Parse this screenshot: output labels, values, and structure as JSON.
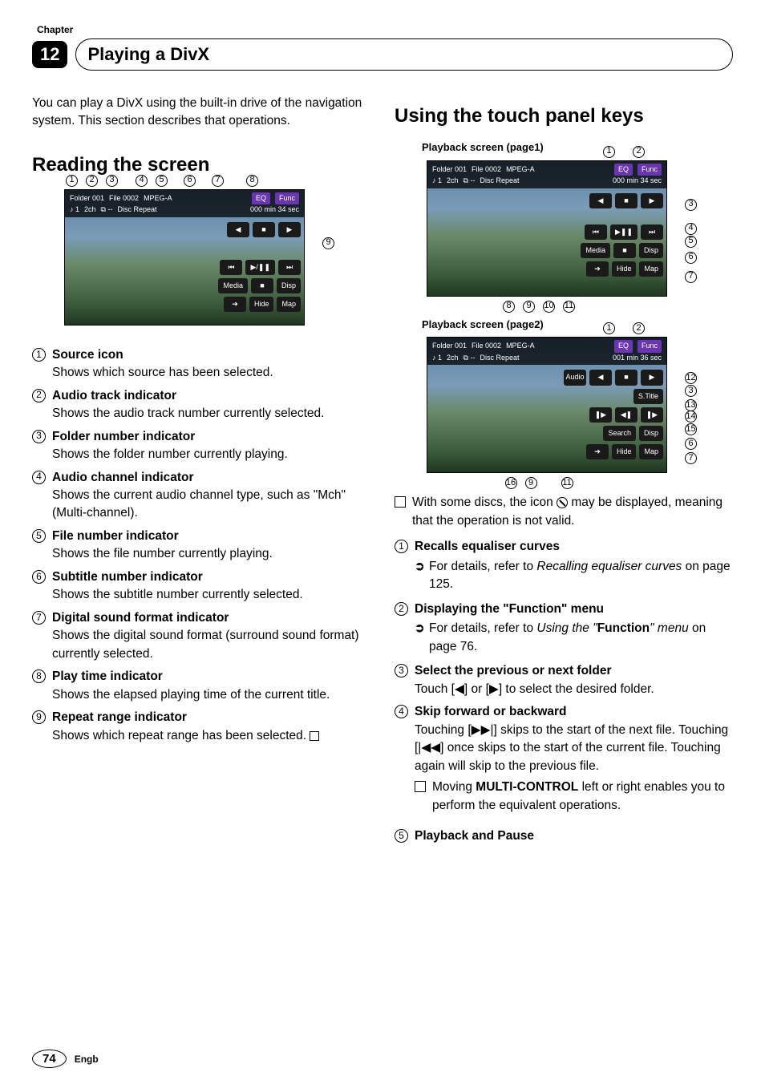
{
  "chapter": {
    "label": "Chapter",
    "number": "12",
    "title": "Playing a DivX"
  },
  "intro": "You can play a DivX using the built-in drive of the navigation system. This section describes that operations.",
  "left": {
    "h2": "Reading the screen",
    "fig": {
      "folder": "Folder 001",
      "file": "File 0002",
      "codec": "MPEG-A",
      "track": "♪ 1",
      "ch": "2ch",
      "sub": "⧉ --",
      "repeat": "Disc Repeat",
      "eq": "EQ",
      "func": "Func",
      "time": "000 min 34 sec",
      "media": "Media",
      "disp": "Disp",
      "hide": "Hide",
      "map": "Map"
    },
    "items": [
      {
        "n": "1",
        "t": "Source icon",
        "d": "Shows which source has been selected."
      },
      {
        "n": "2",
        "t": "Audio track indicator",
        "d": "Shows the audio track number currently selected."
      },
      {
        "n": "3",
        "t": "Folder number indicator",
        "d": "Shows the folder number currently playing."
      },
      {
        "n": "4",
        "t": "Audio channel indicator",
        "d": "Shows the current audio channel type, such as \"Mch\" (Multi-channel)."
      },
      {
        "n": "5",
        "t": "File number indicator",
        "d": "Shows the file number currently playing."
      },
      {
        "n": "6",
        "t": "Subtitle number indicator",
        "d": "Shows the subtitle number currently selected."
      },
      {
        "n": "7",
        "t": "Digital sound format indicator",
        "d": "Shows the digital sound format (surround sound format) currently selected."
      },
      {
        "n": "8",
        "t": "Play time indicator",
        "d": "Shows the elapsed playing time of the current title."
      },
      {
        "n": "9",
        "t": "Repeat range indicator",
        "d": "Shows which repeat range has been selected."
      }
    ]
  },
  "right": {
    "h2": "Using the touch panel keys",
    "fig1_title": "Playback screen (page1)",
    "fig2_title": "Playback screen (page2)",
    "fig1": {
      "folder": "Folder 001",
      "file": "File 0002",
      "codec": "MPEG-A",
      "track": "♪ 1",
      "ch": "2ch",
      "sub": "⧉ --",
      "repeat": "Disc Repeat",
      "eq": "EQ",
      "func": "Func",
      "time": "000 min 34 sec",
      "media": "Media",
      "disp": "Disp",
      "hide": "Hide",
      "map": "Map"
    },
    "fig2": {
      "folder": "Folder 001",
      "file": "File 0002",
      "codec": "MPEG-A",
      "track": "♪ 1",
      "ch": "2ch",
      "sub": "⧉ --",
      "repeat": "Disc Repeat",
      "eq": "EQ",
      "func": "Func",
      "time": "001 min 36 sec",
      "audio": "Audio",
      "stitle": "S.Title",
      "search": "Search",
      "disp": "Disp",
      "hide": "Hide",
      "map": "Map"
    },
    "note": "With some discs, the icon ⊘ may be displayed, meaning that the operation is not valid.",
    "items": [
      {
        "n": "1",
        "t": "Recalls equaliser curves",
        "sub": "For details, refer to Recalling equaliser curves on page 125.",
        "sub_ital_part": "Recalling equaliser curves"
      },
      {
        "n": "2",
        "t": "Displaying the \"Function\" menu",
        "sub": "For details, refer to Using the \"Function\" menu on page 76.",
        "sub_ital_part": "Using the",
        "sub_bold_part": "Function",
        "sub_ital_part2": "\" menu"
      },
      {
        "n": "3",
        "t": "Select the previous or next folder",
        "d": "Touch [◀] or [▶] to select the desired folder."
      },
      {
        "n": "4",
        "t": "Skip forward or backward",
        "d": "Touching [▶▶|] skips to the start of the next file. Touching [|◀◀] once skips to the start of the current file. Touching again will skip to the previous file.",
        "note": "Moving MULTI-CONTROL left or right enables you to perform the equivalent operations.",
        "note_bold": "MULTI-CONTROL"
      },
      {
        "n": "5",
        "t": "Playback and Pause"
      }
    ]
  },
  "footer": {
    "page": "74",
    "lang": "Engb"
  }
}
